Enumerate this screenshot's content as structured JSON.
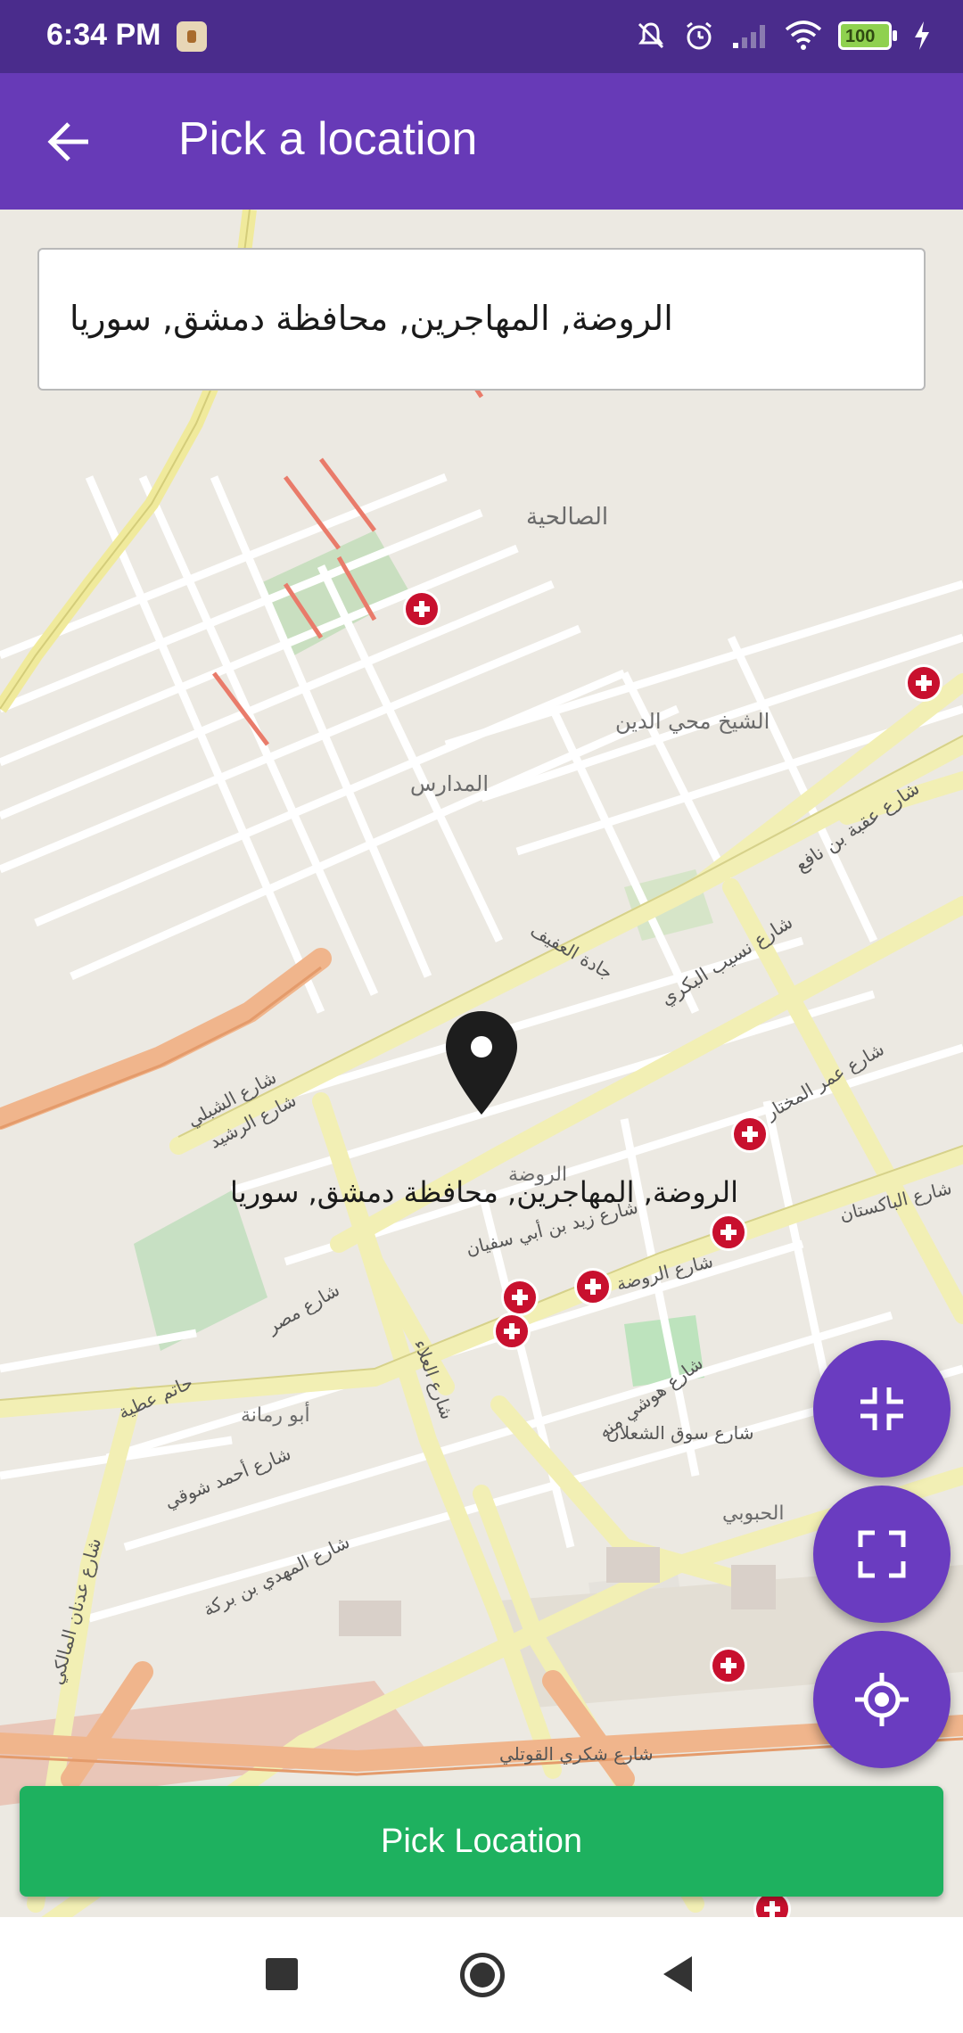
{
  "status_bar": {
    "time": "6:34 PM",
    "battery": "100"
  },
  "app_bar": {
    "back_icon": "arrow-back-icon",
    "title": "Pick a location"
  },
  "search": {
    "value": "الروضة, المهاجرين, محافظة دمشق, سوريا"
  },
  "map": {
    "pin_label": "الروضة, المهاجرين, محافظة دمشق, سوريا",
    "labels": [
      "الصالحية",
      "الشيخ محي الدين",
      "المدارس",
      "شارع عقبة بن نافع",
      "شارع نسيب البكري",
      "جادة العفيف",
      "شارع الرشيد",
      "شارع الشبلي",
      "شارع عمر المختار",
      "شارع الباكستان",
      "شارع مصر",
      "شارع المهدي بن بركة",
      "شارع عدنان المالكي",
      "شارع العلاء",
      "شارع هوشي منه",
      "شارع سوق الشعلان",
      "الحبوبي",
      "أبو رمانة",
      "حاتم عطية",
      "شارع أحمد شوقي",
      "شارع شكري القوتلي",
      "شارع الروضة",
      "الروضة",
      "شارع زيد بن أبي سفيان"
    ]
  },
  "fabs": {
    "collapse_icon": "fullscreen-exit-icon",
    "expand_icon": "fullscreen-icon",
    "locate_icon": "my-location-icon"
  },
  "pick_button": {
    "label": "Pick Location"
  },
  "colors": {
    "app_bar": "#673ab7",
    "status_bar": "#4a2c8c",
    "fab": "#6a3cc0",
    "pick_button": "#1eb15f",
    "hospital": "#c8102e"
  }
}
